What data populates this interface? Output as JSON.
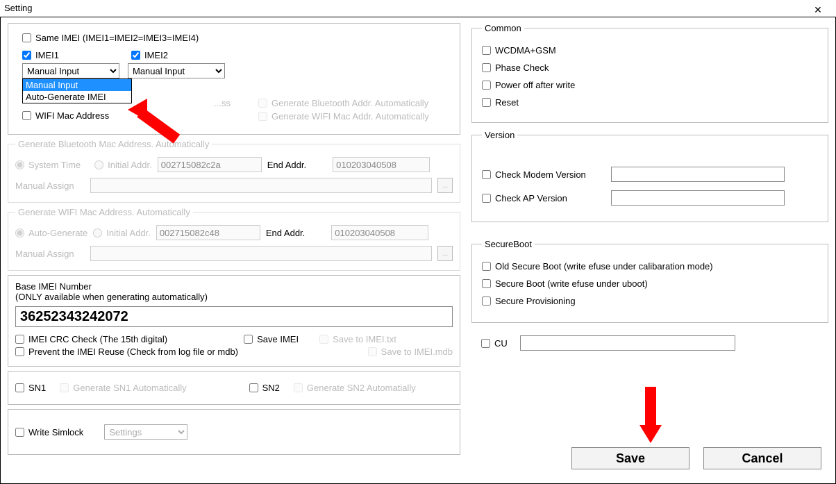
{
  "title": "Setting",
  "sameImei": {
    "label": "Same IMEI (IMEI1=IMEI2=IMEI3=IMEI4)",
    "checked": false
  },
  "imei1": {
    "label": "IMEI1",
    "checked": true,
    "mode": "Manual Input"
  },
  "imei2": {
    "label": "IMEI2",
    "checked": true,
    "mode": "Manual Input"
  },
  "dropdownOptions": {
    "opt1": "Manual Input",
    "opt2": "Auto-Generate IMEI"
  },
  "btAddr": {
    "label": "...ss",
    "auto": "Generate Bluetooth Addr. Automatically"
  },
  "wifiAddr": {
    "label": "WIFI Mac Address",
    "auto": "Generate WIFI Mac Addr. Automatically"
  },
  "genBt": {
    "legend": "Generate Bluetooth Mac Address. Automatically",
    "sysTime": "System Time",
    "initAddr": "Initial Addr.",
    "initVal": "002715082c2a",
    "endAddr": "End Addr.",
    "endVal": "010203040508",
    "manual": "Manual Assign"
  },
  "genWifi": {
    "legend": "Generate WIFI Mac Address. Automatically",
    "autoGen": "Auto-Generate",
    "initAddr": "Initial Addr.",
    "initVal": "002715082c48",
    "endAddr": "End Addr.",
    "endVal": "010203040508",
    "manual": "Manual Assign"
  },
  "baseImei": {
    "title": "Base IMEI Number",
    "sub": "(ONLY available when generating automatically)",
    "value": "36252343242072",
    "crc": "IMEI CRC Check (The 15th digital)",
    "save": "Save IMEI",
    "saveTxt": "Save to IMEI.txt",
    "prevent": "Prevent the IMEI Reuse (Check from log file or mdb)",
    "saveMdb": "Save to IMEI.mdb"
  },
  "sn": {
    "sn1": "SN1",
    "gen1": "Generate SN1 Automatically",
    "sn2": "SN2",
    "gen2": "Generate SN2 Automatially"
  },
  "simlock": {
    "label": "Write Simlock",
    "combo": "Settings"
  },
  "common": {
    "legend": "Common",
    "wcdma": "WCDMA+GSM",
    "phase": "Phase Check",
    "poweroff": "Power off after write",
    "reset": "Reset"
  },
  "version": {
    "legend": "Version",
    "modem": "Check Modem Version",
    "ap": "Check AP Version"
  },
  "secure": {
    "legend": "SecureBoot",
    "old": "Old Secure Boot (write efuse under calibaration  mode)",
    "sb": "Secure Boot (write efuse under uboot)",
    "prov": "Secure Provisioning"
  },
  "cu": "CU",
  "buttons": {
    "save": "Save",
    "cancel": "Cancel"
  },
  "browse": "..."
}
